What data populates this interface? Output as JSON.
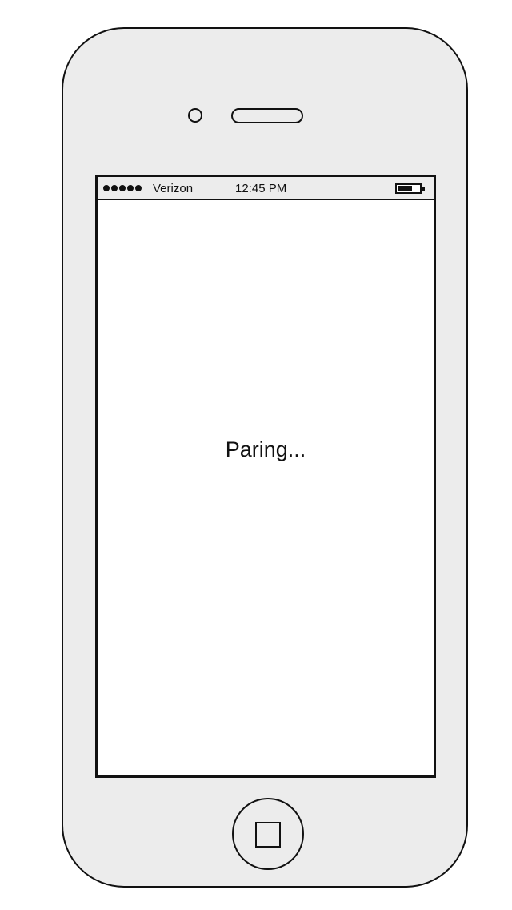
{
  "status_bar": {
    "signal_dots": 5,
    "carrier": "Verizon",
    "time": "12:45 PM",
    "battery_level": 0.65,
    "battery_icon": "battery-icon"
  },
  "main": {
    "message": "Paring..."
  },
  "device": {
    "home_button_icon": "home-square-icon"
  },
  "colors": {
    "outline": "#111111",
    "bezel": "#ececec",
    "screen": "#ffffff"
  }
}
